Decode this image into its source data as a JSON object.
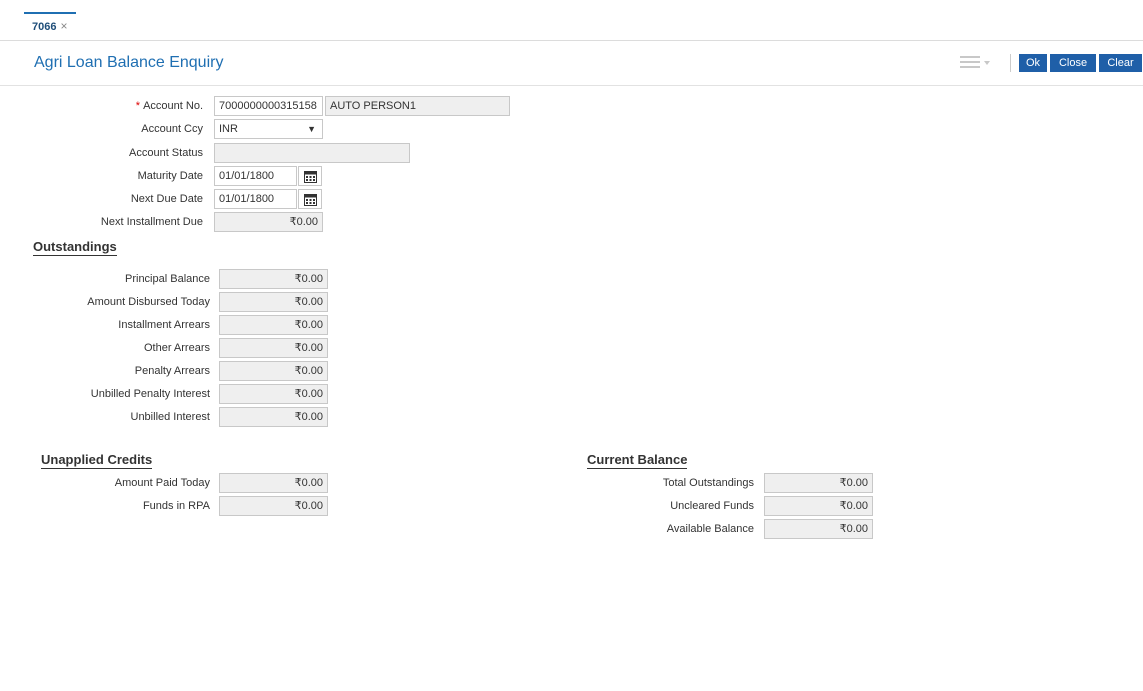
{
  "tab": {
    "label": "7066",
    "close": "×"
  },
  "page": {
    "title": "Agri Loan Balance Enquiry"
  },
  "toolbar": {
    "ok": "Ok",
    "close": "Close",
    "clear": "Clear"
  },
  "account": {
    "account_no_label": "Account No.",
    "required_mark": "*",
    "account_no": "7000000000315158",
    "account_name": "AUTO  PERSON1",
    "ccy_label": "Account Ccy",
    "ccy": "INR",
    "status_label": "Account Status",
    "status": "",
    "maturity_label": "Maturity Date",
    "maturity": "01/01/1800",
    "next_due_label": "Next Due Date",
    "next_due": "01/01/1800",
    "next_install_label": "Next Installment Due",
    "next_install": "₹0.00"
  },
  "outstandings": {
    "title": "Outstandings",
    "rows": [
      {
        "label": "Principal Balance",
        "value": "₹0.00"
      },
      {
        "label": "Amount Disbursed Today",
        "value": "₹0.00"
      },
      {
        "label": "Installment Arrears",
        "value": "₹0.00"
      },
      {
        "label": "Other Arrears",
        "value": "₹0.00"
      },
      {
        "label": "Penalty Arrears",
        "value": "₹0.00"
      },
      {
        "label": "Unbilled Penalty Interest",
        "value": "₹0.00"
      },
      {
        "label": "Unbilled Interest",
        "value": "₹0.00"
      }
    ]
  },
  "unapplied": {
    "title": "Unapplied Credits",
    "rows": [
      {
        "label": "Amount Paid Today",
        "value": "₹0.00"
      },
      {
        "label": "Funds in RPA",
        "value": "₹0.00"
      }
    ]
  },
  "current": {
    "title": "Current Balance",
    "rows": [
      {
        "label": "Total Outstandings",
        "value": "₹0.00"
      },
      {
        "label": "Uncleared Funds",
        "value": "₹0.00"
      },
      {
        "label": "Available Balance",
        "value": "₹0.00"
      }
    ]
  }
}
